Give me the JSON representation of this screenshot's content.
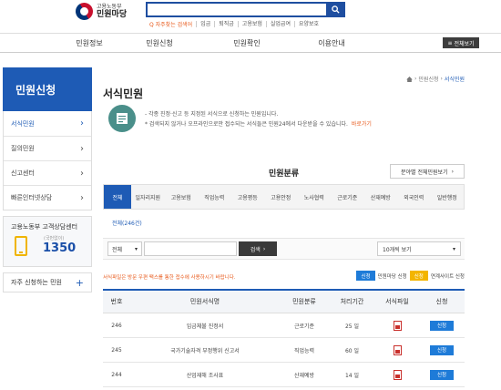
{
  "header": {
    "logo_small": "고용노동부",
    "logo_big": "민원마당",
    "search_placeholder": "",
    "quick_first": "Q 자주찾는 검색어",
    "quick_links": [
      "임금",
      "퇴직금",
      "고용보험",
      "실업급여",
      "요양보호"
    ]
  },
  "gnb": {
    "items": [
      "민원정보",
      "민원신청",
      "민원확인",
      "이용안내"
    ],
    "all_label": "전체보기"
  },
  "sidebar": {
    "title": "민원신청",
    "items": [
      "서식민원",
      "질의민원",
      "신고센터",
      "빠른인터넷상담"
    ],
    "call_center": {
      "title": "고용노동부 고객상담센터",
      "sub": "(국번없이)",
      "number": "1350"
    },
    "frequent": "자주 신청하는 민원"
  },
  "main": {
    "breadcrumb": [
      "민원신청",
      "서식민원"
    ],
    "title": "서식민원",
    "intro_lines": [
      "- 각종 진정·신고 등 지정된 서식으로 신청하는 민원입니다.",
      "* 검색되지 않거나 오프라인으로만 접수되는 서식들은 민원24에서 다운받을 수 있습니다."
    ],
    "intro_link": "바로가기",
    "category_heading": "민원분류",
    "sort_button": "분야별 전체민원보기",
    "tabs": [
      "전체",
      "일자리지원",
      "고용보험",
      "직업능력",
      "고용평등",
      "고용안정",
      "노사협력",
      "근로기준",
      "산재예방",
      "외국인력",
      "일반행정"
    ],
    "total_count": "전체(246건)",
    "filter": {
      "scope": "전체",
      "search_button": "검색",
      "per_page": "10개씩 보기"
    },
    "notice": "서식파일은 방문 우편 팩스를 통한 접수에 사용하시기 바랍니다.",
    "legend": {
      "blue_badge": "신청",
      "blue_text": "민원마당 신청",
      "yellow_badge": "신청",
      "yellow_text": "연계사이트 신청"
    },
    "table": {
      "headers": [
        "번호",
        "민원서식명",
        "민원분류",
        "처리기간",
        "서식파일",
        "신청"
      ],
      "rows": [
        {
          "no": "246",
          "name": "임금체불 진정서",
          "category": "근로기준",
          "period": "25 일",
          "apply": "신청"
        },
        {
          "no": "245",
          "name": "국가기술자격 부정행위 신고서",
          "category": "직업능력",
          "period": "60 일",
          "apply": "신청"
        },
        {
          "no": "244",
          "name": "산업재해 조사표",
          "category": "산재예방",
          "period": "14 일",
          "apply": "신청"
        }
      ]
    }
  },
  "colors": {
    "primary": "#1e5bb5",
    "accent": "#e85a1c",
    "apply_blue": "#1e7bd8",
    "link_yellow": "#f3b500"
  }
}
